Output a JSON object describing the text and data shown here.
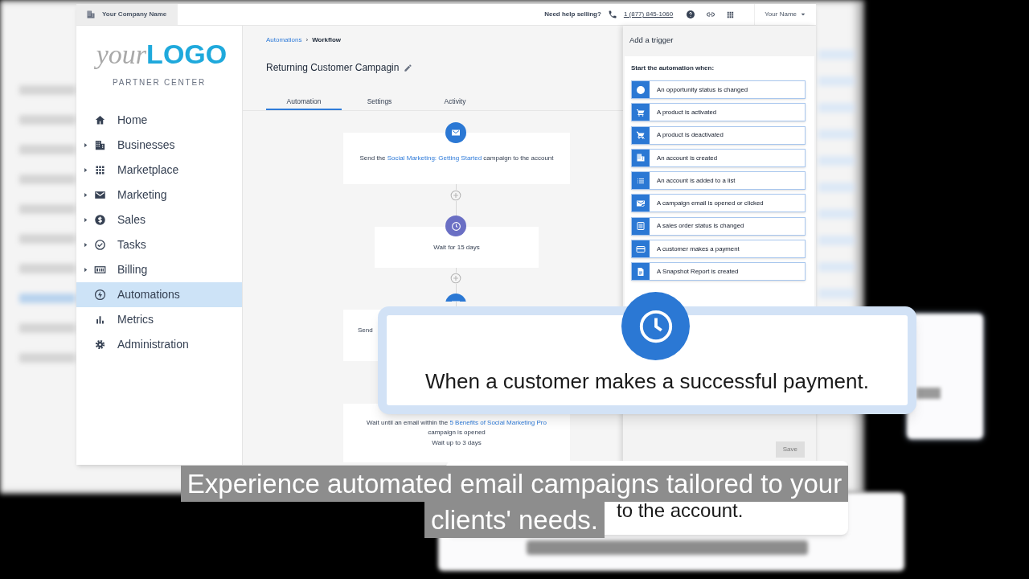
{
  "top_bar": {
    "company": "Your Company Name",
    "help_text": "Need help selling?",
    "phone": "1 (877) 845-1060",
    "user": "Your Name"
  },
  "logo": {
    "light": "your",
    "bold": "LOGO",
    "subtitle": "PARTNER CENTER"
  },
  "sidebar": {
    "items": [
      {
        "label": "Home",
        "expandable": false,
        "selected": false
      },
      {
        "label": "Businesses",
        "expandable": true,
        "selected": false
      },
      {
        "label": "Marketplace",
        "expandable": true,
        "selected": false
      },
      {
        "label": "Marketing",
        "expandable": true,
        "selected": false
      },
      {
        "label": "Sales",
        "expandable": true,
        "selected": false
      },
      {
        "label": "Tasks",
        "expandable": true,
        "selected": false
      },
      {
        "label": "Billing",
        "expandable": true,
        "selected": false
      },
      {
        "label": "Automations",
        "expandable": false,
        "selected": true
      },
      {
        "label": "Metrics",
        "expandable": false,
        "selected": false
      },
      {
        "label": "Administration",
        "expandable": false,
        "selected": false
      }
    ]
  },
  "breadcrumb": {
    "items": [
      {
        "label": "Automations",
        "kind": "link"
      },
      {
        "label": "Workflow",
        "kind": "current"
      }
    ],
    "separator": "›"
  },
  "title": "Returning Customer Campagin",
  "tabs": [
    {
      "label": "Automation",
      "selected": true
    },
    {
      "label": "Settings",
      "selected": false
    },
    {
      "label": "Activity",
      "selected": false
    }
  ],
  "workflow": {
    "steps": [
      {
        "kind": "email",
        "lines": [
          [
            {
              "text": "Send the ",
              "kind": "text"
            },
            {
              "text": "Social Marketing: Getting Started",
              "kind": "link"
            },
            {
              "text": " campaign to the account",
              "kind": "text"
            }
          ]
        ]
      },
      {
        "kind": "wait",
        "lines": [
          [
            {
              "text": "Wait for 15 days",
              "kind": "text"
            }
          ]
        ]
      },
      {
        "kind": "email",
        "lines": [
          [
            {
              "text": "Send",
              "kind": "text"
            }
          ]
        ]
      },
      {
        "kind": "wait_until",
        "lines": [
          [
            {
              "text": "Wait until an email within the ",
              "kind": "text"
            },
            {
              "text": "5 Benefits of Social Marketing Pro",
              "kind": "link"
            },
            {
              "text": " campaign is opened",
              "kind": "text"
            }
          ],
          [
            {
              "text": "Wait up to 3 days",
              "kind": "text"
            }
          ]
        ]
      }
    ]
  },
  "trigger_panel": {
    "title": "Add a trigger",
    "heading": "Start the automation when:",
    "triggers": [
      {
        "label": "An opportunity status is changed"
      },
      {
        "label": "A product is activated"
      },
      {
        "label": "A product is deactivated"
      },
      {
        "label": "An account is created"
      },
      {
        "label": "An account is added to a list"
      },
      {
        "label": "A campaign email is opened or clicked"
      },
      {
        "label": "A sales order status is changed"
      },
      {
        "label": "A customer makes a payment"
      },
      {
        "label": "A Snapshot Report is created"
      }
    ],
    "save": {
      "label": "Save",
      "disabled": true
    }
  },
  "callouts": [
    {
      "kind": "trigger",
      "text": "When a customer makes a successful payment."
    },
    {
      "kind": "action",
      "text": "to the account."
    }
  ],
  "caption": [
    "Experience automated email campaigns tailored to your",
    "clients' needs."
  ]
}
